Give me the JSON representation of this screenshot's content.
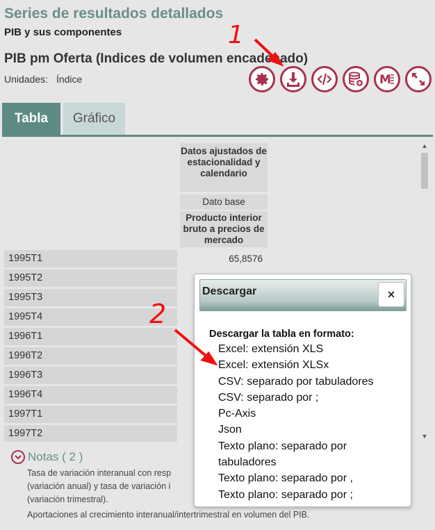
{
  "header": {
    "title": "Series de resultados detallados",
    "subtitle": "PIB y sus componentes"
  },
  "series": {
    "title": "PIB pm Oferta (Indices de volumen encadenado)",
    "units_label": "Unidades:",
    "units_value": "Índice"
  },
  "toolbar": {
    "buttons": [
      "gear-icon",
      "download-icon",
      "embed-code-icon",
      "database-add-icon",
      "markdown-icon",
      "expand-icon"
    ]
  },
  "tabs": [
    {
      "label": "Tabla",
      "active": true
    },
    {
      "label": "Gráfico",
      "active": false
    }
  ],
  "table": {
    "header_adjust": "Datos ajustados de estacionalidad y calendario",
    "header_base": "Dato base",
    "header_product": "Producto interior bruto a precios de mercado",
    "rows": [
      {
        "period": "1995T1",
        "value": "65,8576"
      },
      {
        "period": "1995T2",
        "value": ""
      },
      {
        "period": "1995T3",
        "value": ""
      },
      {
        "period": "1995T4",
        "value": ""
      },
      {
        "period": "1996T1",
        "value": ""
      },
      {
        "period": "1996T2",
        "value": ""
      },
      {
        "period": "1996T3",
        "value": ""
      },
      {
        "period": "1996T4",
        "value": ""
      },
      {
        "period": "1997T1",
        "value": ""
      },
      {
        "period": "1997T2",
        "value": ""
      }
    ]
  },
  "notes": {
    "label": "Notas ( 2 )",
    "lines": [
      "Tasa de variación interanual con resp",
      "(variación anual) y tasa de variación i",
      "(variación trimestral).",
      "Aportaciones al crecimiento interanual/intertrimestral en volumen del PIB."
    ]
  },
  "dialog": {
    "title": "Descargar",
    "close_label": "×",
    "heading": "Descargar la tabla en formato:",
    "options": [
      "Excel: extensión XLS",
      "Excel: extensión XLSx",
      "CSV: separado por tabuladores",
      "CSV: separado por ;",
      "Pc-Axis",
      "Json",
      "Texto plano: separado por tabuladores",
      "Texto plano: separado por ,",
      "Texto plano: separado por ;"
    ]
  },
  "annotations": {
    "step1": "1",
    "step2": "2",
    "color": "#ee1111"
  },
  "colors": {
    "accent": "#a8324f",
    "teal": "#5e8a84",
    "teal_light": "#c8d8d6"
  }
}
